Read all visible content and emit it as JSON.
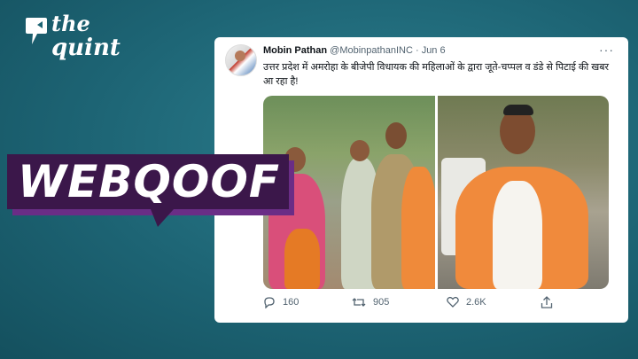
{
  "brand": {
    "logo_line1": "the",
    "logo_line2": "quint"
  },
  "tweet": {
    "author_name": "Mobin Pathan",
    "handle": "@MobinpathanINC",
    "separator": "·",
    "date": "Jun 6",
    "more": "···",
    "text": "उत्तर प्रदेश में अमरोहा के बीजेपी विधायक की महिलाओं के द्वारा जूते-चप्पल व डंडे से पिटाई की खबर आ रहा है!",
    "replies": "160",
    "retweets": "905",
    "likes": "2.6K"
  },
  "badge": {
    "label": "WEBQOOF",
    "color": "#3b174a"
  },
  "colors": {
    "background": "#1d6474",
    "badge_purple": "#3b174a"
  }
}
